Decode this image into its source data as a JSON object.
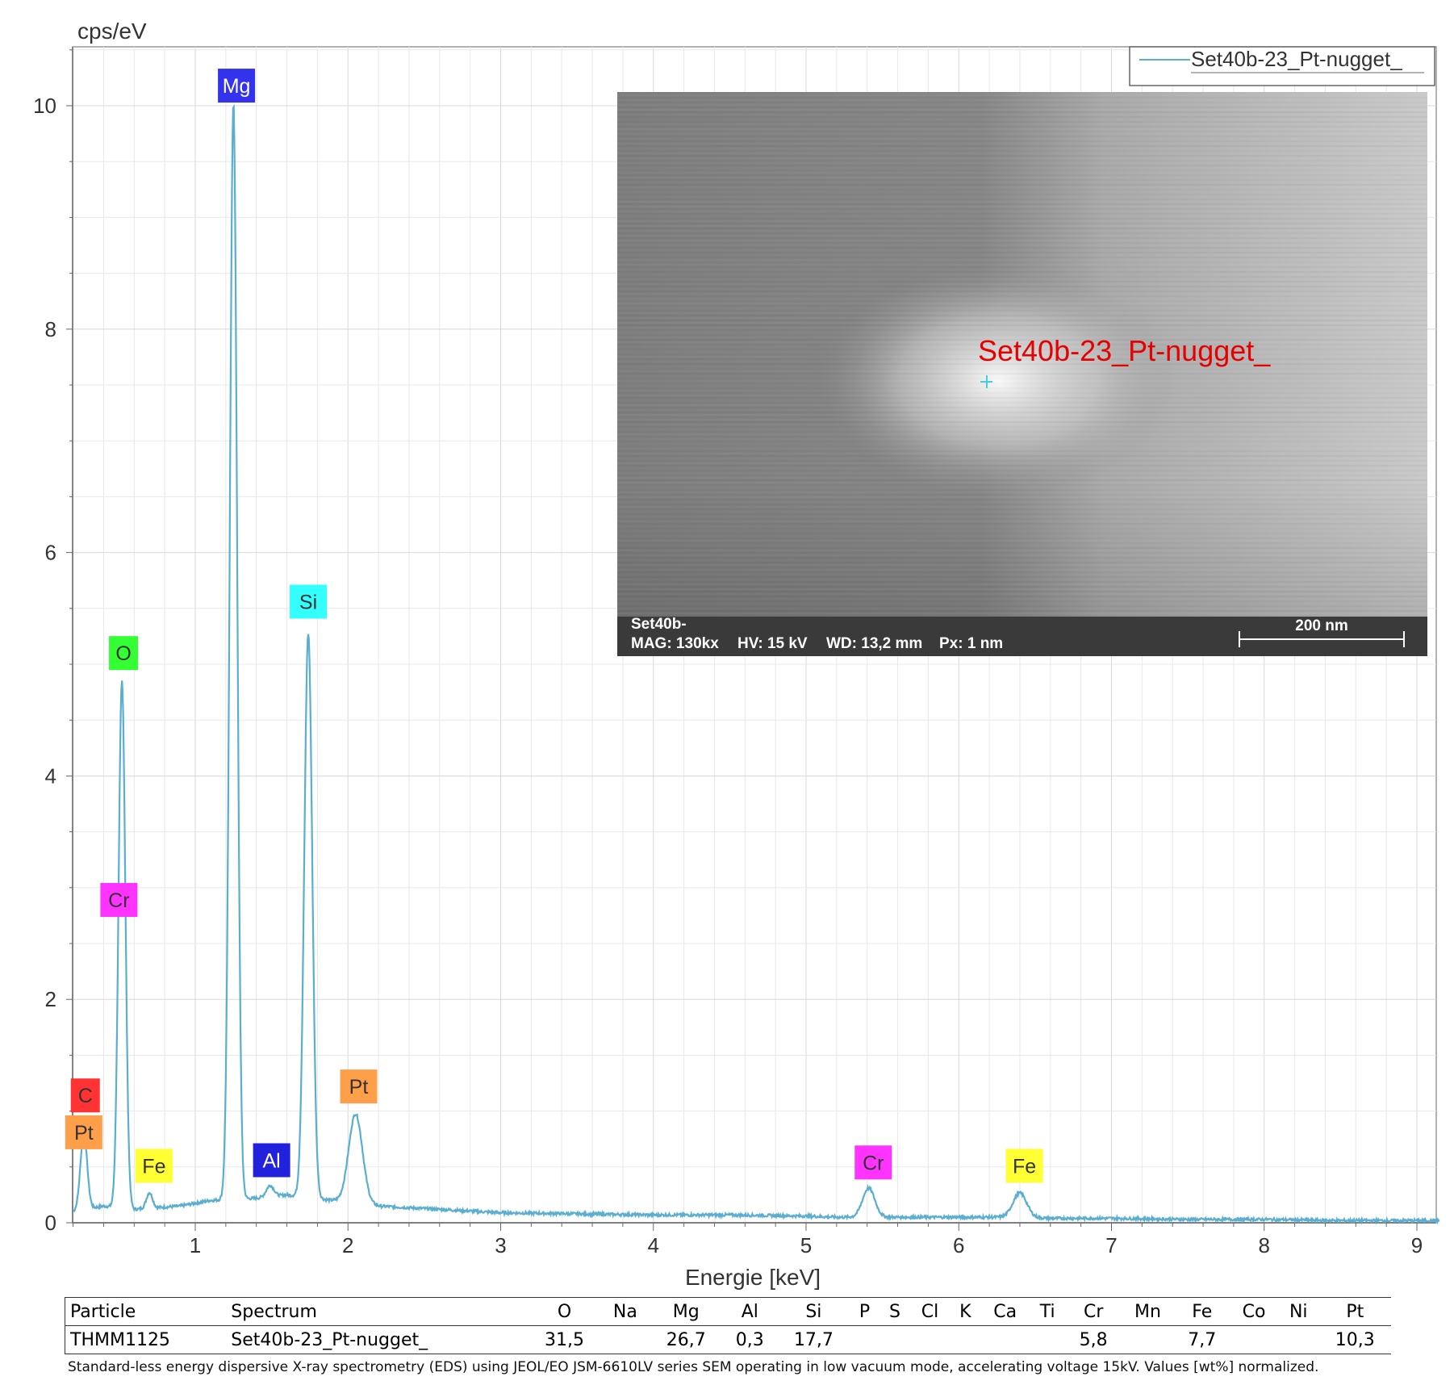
{
  "chart_data": {
    "type": "line",
    "ylabel": "cps/eV",
    "xlabel": "Energie [keV]",
    "xlim": [
      0.2,
      9.15
    ],
    "ylim": [
      0,
      10.5
    ],
    "x_ticks": [
      1,
      2,
      3,
      4,
      5,
      6,
      7,
      8,
      9
    ],
    "y_ticks": [
      0,
      2,
      4,
      6,
      8,
      10
    ],
    "grid": true,
    "legend": {
      "position": "top-right",
      "entries": [
        "Set40b-23_Pt-nugget_"
      ]
    },
    "series": [
      {
        "name": "Set40b-23_Pt-nugget_",
        "color": "#5aaecf",
        "baseline": [
          [
            0.2,
            0.1
          ],
          [
            0.4,
            0.15
          ],
          [
            0.6,
            0.12
          ],
          [
            0.9,
            0.15
          ],
          [
            1.1,
            0.2
          ],
          [
            1.4,
            0.22
          ],
          [
            1.6,
            0.25
          ],
          [
            2.2,
            0.15
          ],
          [
            2.6,
            0.12
          ],
          [
            3.0,
            0.09
          ],
          [
            3.5,
            0.08
          ],
          [
            4.0,
            0.07
          ],
          [
            4.5,
            0.07
          ],
          [
            5.0,
            0.06
          ],
          [
            5.2,
            0.05
          ],
          [
            5.6,
            0.05
          ],
          [
            6.0,
            0.05
          ],
          [
            6.3,
            0.05
          ],
          [
            6.6,
            0.04
          ],
          [
            7.0,
            0.04
          ],
          [
            7.5,
            0.03
          ],
          [
            8.0,
            0.03
          ],
          [
            8.5,
            0.02
          ],
          [
            9.15,
            0.02
          ]
        ],
        "peaks": [
          {
            "x": 0.27,
            "y": 0.68,
            "w": 0.022
          },
          {
            "x": 0.52,
            "y": 4.72,
            "w": 0.022
          },
          {
            "x": 0.7,
            "y": 0.14,
            "w": 0.02
          },
          {
            "x": 1.25,
            "y": 9.8,
            "w": 0.024
          },
          {
            "x": 1.49,
            "y": 0.1,
            "w": 0.025
          },
          {
            "x": 1.74,
            "y": 5.05,
            "w": 0.026
          },
          {
            "x": 2.05,
            "y": 0.8,
            "w": 0.045
          },
          {
            "x": 5.41,
            "y": 0.26,
            "w": 0.04
          },
          {
            "x": 6.4,
            "y": 0.22,
            "w": 0.045
          }
        ]
      }
    ],
    "peak_labels": [
      {
        "text": "C",
        "x": 0.28,
        "y": 1.14,
        "color": "#ff3333"
      },
      {
        "text": "Pt",
        "x": 0.27,
        "y": 0.81,
        "color": "#ff9f4a"
      },
      {
        "text": "O",
        "x": 0.53,
        "y": 5.1,
        "color": "#33ff33"
      },
      {
        "text": "Cr",
        "x": 0.5,
        "y": 2.89,
        "color": "#ff33ff"
      },
      {
        "text": "Fe",
        "x": 0.73,
        "y": 0.51,
        "color": "#ffff33"
      },
      {
        "text": "Mg",
        "x": 1.27,
        "y": 10.18,
        "color": "#3333ee",
        "text_color": "#ffffff"
      },
      {
        "text": "Al",
        "x": 1.5,
        "y": 0.56,
        "color": "#2222dd",
        "text_color": "#ffffff"
      },
      {
        "text": "Si",
        "x": 1.74,
        "y": 5.56,
        "color": "#33ffff"
      },
      {
        "text": "Pt",
        "x": 2.07,
        "y": 1.22,
        "color": "#ff9f4a"
      },
      {
        "text": "Cr",
        "x": 5.44,
        "y": 0.54,
        "color": "#ff33ff"
      },
      {
        "text": "Fe",
        "x": 6.43,
        "y": 0.51,
        "color": "#ffff33"
      }
    ]
  },
  "sem": {
    "label": "Set40b-23_Pt-nugget_",
    "info_line1": "Set40b-",
    "mag": "MAG: 130kx",
    "hv": "HV: 15 kV",
    "wd": "WD: 13,2 mm",
    "px": "Px: 1 nm",
    "scale": "200 nm",
    "marker_color": "#40d0e0"
  },
  "table": {
    "headers": [
      "Particle",
      "Spectrum",
      "O",
      "Na",
      "Mg",
      "Al",
      "Si",
      "P",
      "S",
      "Cl",
      "K",
      "Ca",
      "Ti",
      "Cr",
      "Mn",
      "Fe",
      "Co",
      "Ni",
      "Pt"
    ],
    "row": [
      "THMM1125",
      "Set40b-23_Pt-nugget_",
      "31,5",
      "",
      "26,7",
      "0,3",
      "17,7",
      "",
      "",
      "",
      "",
      "",
      "",
      "5,8",
      "",
      "7,7",
      "",
      "",
      "10,3"
    ]
  },
  "footnote": "Standard-less energy dispersive X-ray spectrometry (EDS) using JEOL/EO JSM-6610LV series SEM operating in low vacuum mode, accelerating voltage 15kV. Values [wt%] normalized."
}
